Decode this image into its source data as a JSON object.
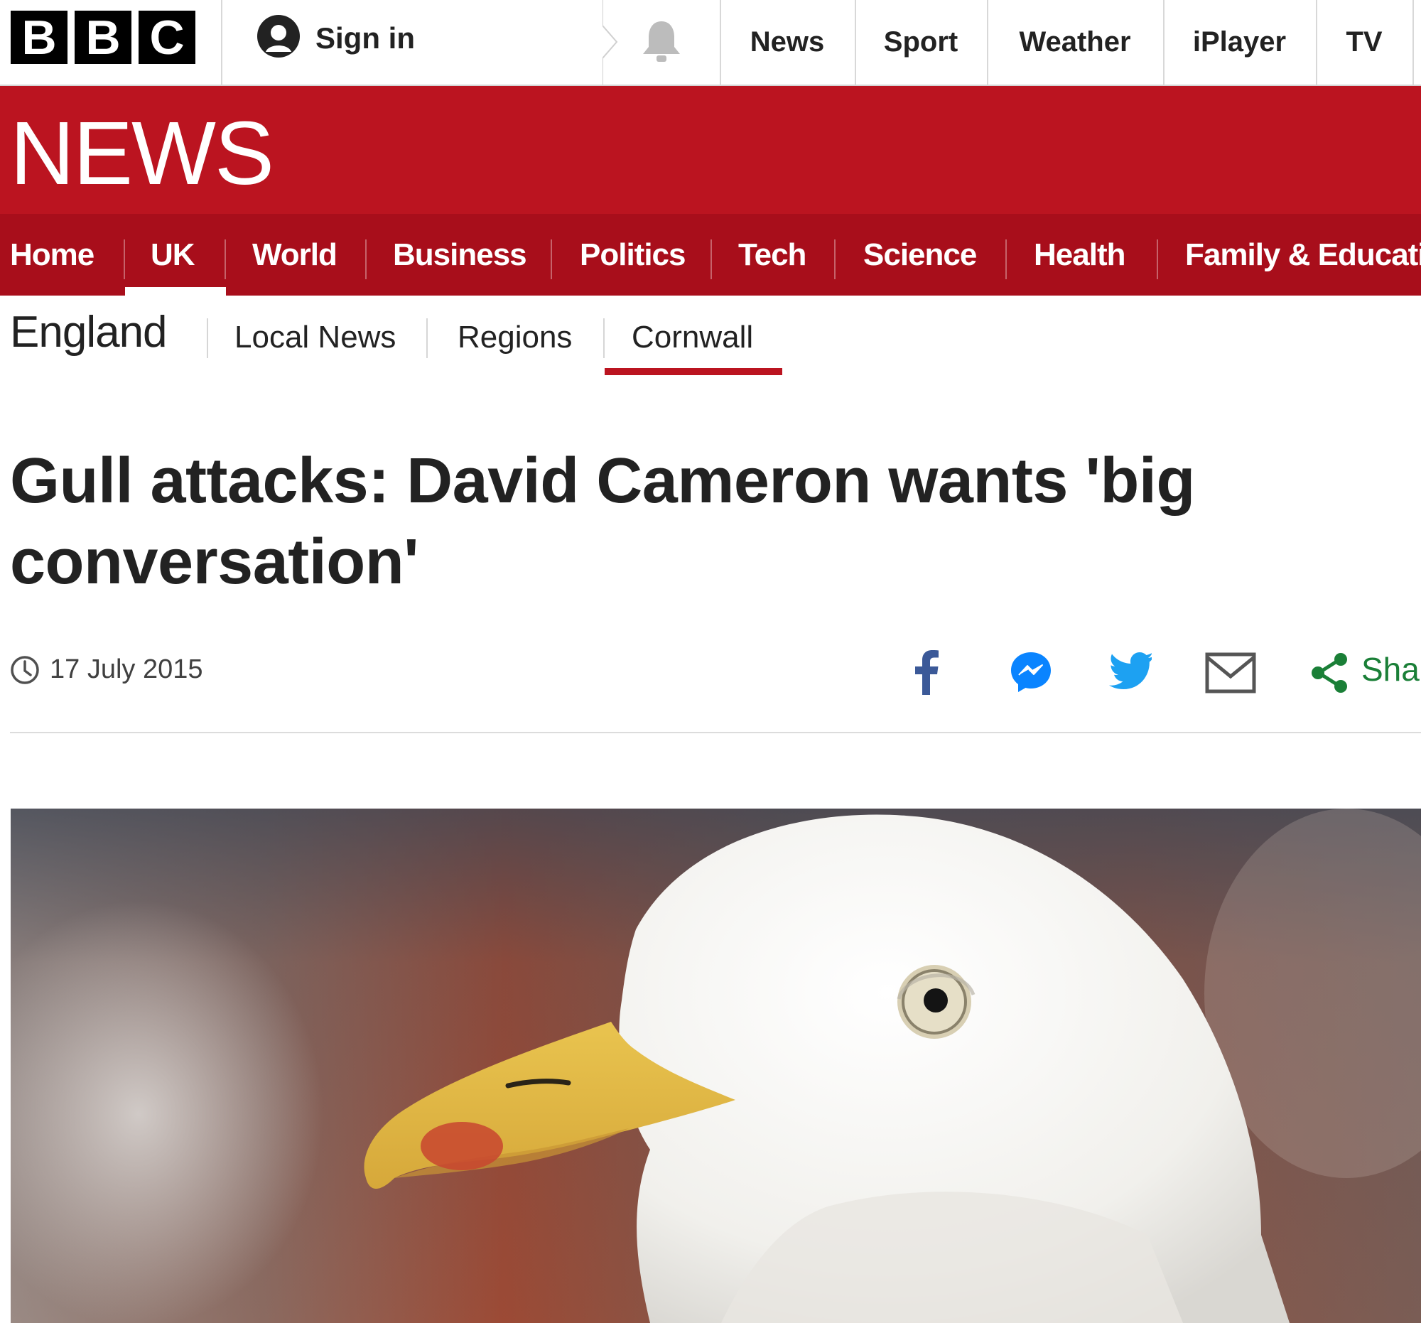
{
  "topbar": {
    "logo_letters": [
      "B",
      "B",
      "C"
    ],
    "sign_in_label": "Sign in",
    "nav": [
      "News",
      "Sport",
      "Weather",
      "iPlayer",
      "TV"
    ]
  },
  "masthead": {
    "title": "NEWS",
    "brand_color": "#bb1420"
  },
  "section_nav": {
    "items": [
      "Home",
      "UK",
      "World",
      "Business",
      "Politics",
      "Tech",
      "Science",
      "Health",
      "Family & Educati"
    ],
    "active": "UK"
  },
  "sub_nav": {
    "title": "England",
    "items": [
      "Local News",
      "Regions",
      "Cornwall"
    ],
    "active": "Cornwall"
  },
  "article": {
    "headline": "Gull attacks: David Cameron wants 'big conversation'",
    "date": "17 July 2015",
    "share_label": "Sha"
  },
  "icons": {
    "signin": "user-icon",
    "notifications": "bell-icon",
    "date": "clock-icon",
    "share": [
      "facebook-icon",
      "messenger-icon",
      "twitter-icon",
      "email-icon",
      "share-icon"
    ]
  }
}
